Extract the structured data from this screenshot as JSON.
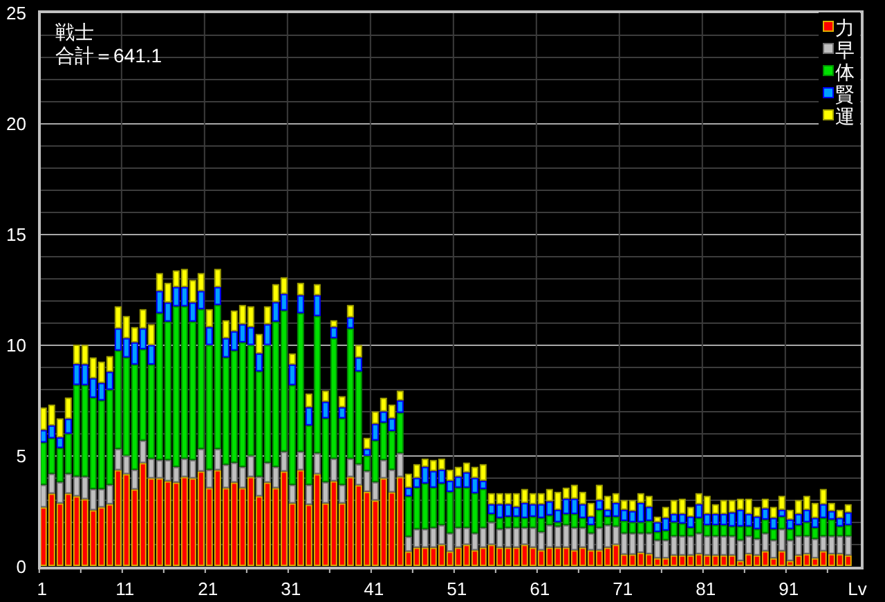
{
  "chart_data": {
    "type": "bar",
    "stacked": true,
    "title": "戦士",
    "annotations": [
      {
        "text": "合計＝641.1"
      }
    ],
    "xlabel": "Lv",
    "grid": true,
    "legend": true,
    "x": [
      1,
      2,
      3,
      4,
      5,
      6,
      7,
      8,
      9,
      10,
      11,
      12,
      13,
      14,
      15,
      16,
      17,
      18,
      19,
      20,
      21,
      22,
      23,
      24,
      25,
      26,
      27,
      28,
      29,
      30,
      31,
      32,
      33,
      34,
      35,
      36,
      37,
      38,
      39,
      40,
      41,
      42,
      43,
      44,
      45,
      46,
      47,
      48,
      49,
      50,
      51,
      52,
      53,
      54,
      55,
      56,
      57,
      58,
      59,
      60,
      61,
      62,
      63,
      64,
      65,
      66,
      67,
      68,
      69,
      70,
      71,
      72,
      73,
      74,
      75,
      76,
      77,
      78,
      79,
      80,
      81,
      82,
      83,
      84,
      85,
      86,
      87,
      88,
      89,
      90,
      91,
      92,
      93,
      94,
      95,
      96,
      97,
      98
    ],
    "xlim": [
      0.6,
      99.6
    ],
    "ylim": [
      0,
      25
    ],
    "yticks": [
      0,
      5,
      10,
      15,
      20,
      25
    ],
    "xticks": [
      1,
      11,
      21,
      31,
      41,
      51,
      61,
      71,
      81,
      91
    ],
    "series": [
      {
        "name": "力",
        "color": "#ff0000",
        "values": [
          2.65,
          3.27,
          2.83,
          3.27,
          3.15,
          3.02,
          2.52,
          2.65,
          2.79,
          4.33,
          4.15,
          3.46,
          4.65,
          3.96,
          3.96,
          3.83,
          3.77,
          4.02,
          3.96,
          4.27,
          3.52,
          4.33,
          3.52,
          3.77,
          3.52,
          4.02,
          3.15,
          3.77,
          3.52,
          4.27,
          2.83,
          4.33,
          2.77,
          4.15,
          2.83,
          3.83,
          2.83,
          4.02,
          3.65,
          3.35,
          2.96,
          3.96,
          3.33,
          4.02,
          0.65,
          0.83,
          0.83,
          0.83,
          0.96,
          0.65,
          0.83,
          0.96,
          0.71,
          0.83,
          0.96,
          0.83,
          0.83,
          0.83,
          0.96,
          0.83,
          0.71,
          0.83,
          0.83,
          0.83,
          0.71,
          0.83,
          0.71,
          0.71,
          0.83,
          0.96,
          0.52,
          0.52,
          0.6,
          0.54,
          0.35,
          0.35,
          0.48,
          0.48,
          0.48,
          0.54,
          0.48,
          0.48,
          0.48,
          0.48,
          0.23,
          0.54,
          0.48,
          0.67,
          0.35,
          0.67,
          0.23,
          0.48,
          0.54,
          0.35,
          0.67,
          0.54,
          0.54,
          0.48
        ]
      },
      {
        "name": "早",
        "color": "#c0c0c0",
        "values": [
          1.02,
          0.9,
          0.96,
          0.9,
          0.9,
          1.02,
          0.96,
          0.83,
          0.88,
          0.96,
          0.83,
          0.89,
          1.02,
          0.89,
          0.83,
          0.96,
          0.71,
          0.83,
          0.83,
          1.02,
          0.83,
          0.96,
          1.06,
          0.9,
          0.96,
          0.96,
          0.89,
          0.9,
          0.96,
          0.9,
          0.84,
          0.84,
          0.9,
          0.95,
          0.96,
          1.02,
          0.84,
          0.83,
          0.95,
          0.94,
          0.83,
          0.83,
          1.02,
          1.08,
          0.68,
          0.84,
          0.84,
          0.9,
          0.89,
          0.83,
          0.9,
          0.77,
          0.77,
          0.9,
          1.02,
          0.84,
          0.9,
          0.9,
          0.77,
          0.9,
          0.83,
          1.02,
          0.96,
          1.02,
          1.02,
          0.9,
          0.77,
          1.02,
          1.02,
          0.83,
          0.96,
          0.96,
          0.88,
          0.94,
          0.82,
          0.82,
          0.87,
          0.87,
          0.87,
          0.94,
          0.87,
          0.87,
          0.87,
          0.87,
          0.94,
          0.81,
          0.75,
          0.81,
          0.82,
          1.0,
          0.94,
          0.87,
          0.81,
          0.88,
          0.68,
          0.81,
          0.81,
          0.87
        ]
      },
      {
        "name": "体",
        "color": "#00e000",
        "values": [
          1.91,
          1.6,
          1.54,
          1.81,
          4.13,
          4.13,
          4.12,
          4.0,
          4.29,
          4.44,
          4.44,
          4.75,
          4.12,
          4.25,
          6.63,
          6.25,
          7.25,
          6.88,
          6.25,
          6.31,
          5.63,
          6.5,
          4.84,
          5.06,
          5.62,
          5.0,
          4.75,
          5.31,
          6.56,
          6.37,
          4.5,
          6.25,
          2.68,
          6.19,
          2.88,
          5.44,
          3.0,
          5.88,
          4.19,
          0.69,
          1.88,
          1.69,
          1.75,
          1.82,
          1.82,
          1.87,
          2.06,
          1.81,
          1.88,
          1.87,
          1.81,
          1.81,
          1.81,
          1.75,
          0.37,
          0.5,
          0.5,
          0.5,
          0.44,
          0.5,
          0.63,
          0.44,
          0.19,
          0.5,
          0.62,
          0.44,
          0.37,
          0.81,
          0.38,
          0.44,
          0.56,
          0.5,
          0.5,
          0.56,
          0.37,
          0.43,
          0.63,
          0.57,
          0.38,
          0.69,
          0.5,
          0.5,
          0.5,
          0.44,
          0.62,
          0.44,
          0.44,
          0.62,
          0.5,
          0.56,
          0.5,
          0.5,
          0.63,
          0.5,
          0.82,
          0.75,
          0.44,
          0.5
        ]
      },
      {
        "name": "賢",
        "color": "#00a0ff",
        "values": [
          0.56,
          0.58,
          0.48,
          0.67,
          0.94,
          0.94,
          0.88,
          0.79,
          0.81,
          1.0,
          0.87,
          1.0,
          0.94,
          0.88,
          1.0,
          0.86,
          0.87,
          0.87,
          0.86,
          0.82,
          0.81,
          0.81,
          0.87,
          0.87,
          0.82,
          0.81,
          0.81,
          0.94,
          0.88,
          0.75,
          0.93,
          0.81,
          0.82,
          0.94,
          0.75,
          0.5,
          0.5,
          0.5,
          0.63,
          0.31,
          0.75,
          0.5,
          0.57,
          0.56,
          0.39,
          0.44,
          0.75,
          0.75,
          0.62,
          0.5,
          0.5,
          0.69,
          0.69,
          0.37,
          0.44,
          0.62,
          0.56,
          0.44,
          0.68,
          0.56,
          0.62,
          0.63,
          0.56,
          0.69,
          0.69,
          0.62,
          0.38,
          0.44,
          0.31,
          0.62,
          0.5,
          0.5,
          0.87,
          0.63,
          0.44,
          0.57,
          0.37,
          0.43,
          0.5,
          0.62,
          0.5,
          0.5,
          0.5,
          0.63,
          0.75,
          0.56,
          0.56,
          0.5,
          0.5,
          0.31,
          0.43,
          0.5,
          0.56,
          0.44,
          0.62,
          0.38,
          0.38,
          0.57
        ]
      },
      {
        "name": "運",
        "color": "#ffff00",
        "values": [
          1.02,
          0.94,
          0.86,
          0.96,
          0.88,
          0.88,
          0.94,
          0.96,
          0.71,
          1.0,
          1.0,
          0.69,
          0.87,
          0.94,
          0.81,
          0.89,
          0.75,
          0.82,
          1.02,
          0.81,
          0.81,
          0.82,
          0.81,
          0.94,
          0.87,
          0.94,
          0.88,
          0.81,
          0.81,
          0.75,
          0.5,
          0.56,
          0.62,
          0.5,
          0.5,
          0.31,
          0.5,
          0.56,
          0.56,
          0.5,
          0.56,
          0.62,
          0.62,
          0.44,
          0.63,
          0.62,
          0.37,
          0.5,
          0.5,
          0.5,
          0.44,
          0.44,
          0.5,
          0.75,
          0.5,
          0.5,
          0.5,
          0.62,
          0.63,
          0.5,
          0.5,
          0.56,
          0.81,
          0.5,
          0.63,
          0.56,
          0.62,
          0.69,
          0.63,
          0.44,
          0.44,
          0.5,
          0.44,
          0.5,
          0.25,
          0.5,
          0.63,
          0.69,
          0.44,
          0.5,
          0.82,
          0.44,
          0.63,
          0.56,
          0.5,
          0.69,
          0.44,
          0.44,
          0.5,
          0.63,
          0.44,
          0.63,
          0.63,
          0.68,
          0.69,
          0.37,
          0.37,
          0.37
        ]
      }
    ]
  }
}
